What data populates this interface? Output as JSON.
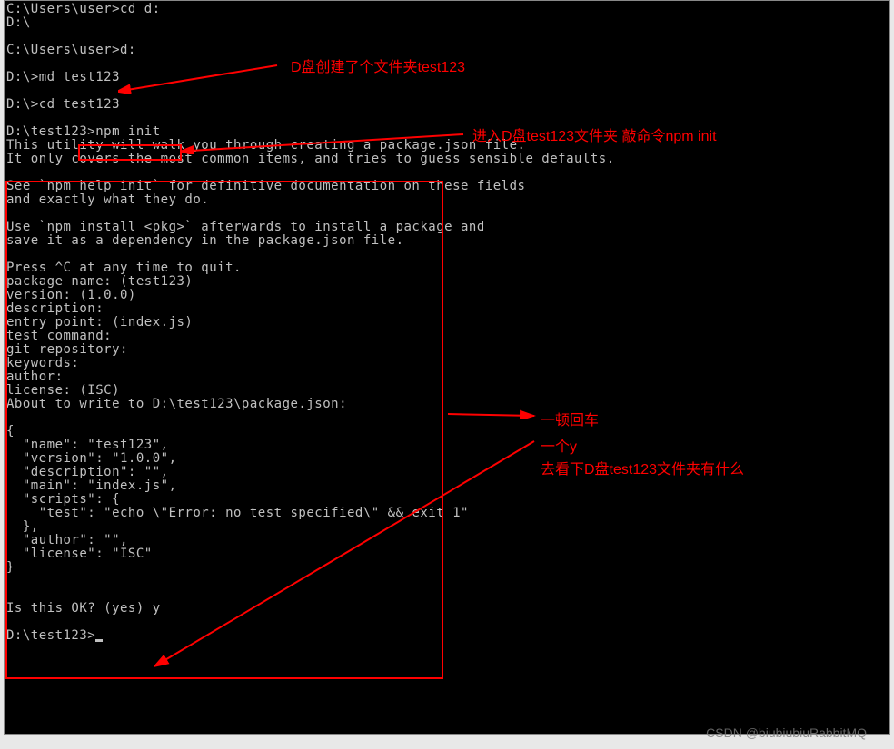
{
  "terminal": {
    "lines": [
      "C:\\Users\\user>cd d:",
      "D:\\",
      "",
      "C:\\Users\\user>d:",
      "",
      "D:\\>md test123",
      "",
      "D:\\>cd test123",
      "",
      "D:\\test123>npm init",
      "This utility will walk you through creating a package.json file.",
      "It only covers the most common items, and tries to guess sensible defaults.",
      "",
      "See `npm help init` for definitive documentation on these fields",
      "and exactly what they do.",
      "",
      "Use `npm install <pkg>` afterwards to install a package and",
      "save it as a dependency in the package.json file.",
      "",
      "Press ^C at any time to quit.",
      "package name: (test123)",
      "version: (1.0.0)",
      "description:",
      "entry point: (index.js)",
      "test command:",
      "git repository:",
      "keywords:",
      "author:",
      "license: (ISC)",
      "About to write to D:\\test123\\package.json:",
      "",
      "{",
      "  \"name\": \"test123\",",
      "  \"version\": \"1.0.0\",",
      "  \"description\": \"\",",
      "  \"main\": \"index.js\",",
      "  \"scripts\": {",
      "    \"test\": \"echo \\\"Error: no test specified\\\" && exit 1\"",
      "  },",
      "  \"author\": \"\",",
      "  \"license\": \"ISC\"",
      "}",
      "",
      "",
      "Is this OK? (yes) y",
      "",
      "D:\\test123>"
    ]
  },
  "annotations": {
    "a1": "D盘创建了个文件夹test123",
    "a2": "进入D盘test123文件夹  敲命令npm init",
    "a3": "一顿回车",
    "a4": "一个y",
    "a5": "去看下D盘test123文件夹有什么"
  },
  "watermark": "CSDN @biubiubiuRabbitMQ"
}
